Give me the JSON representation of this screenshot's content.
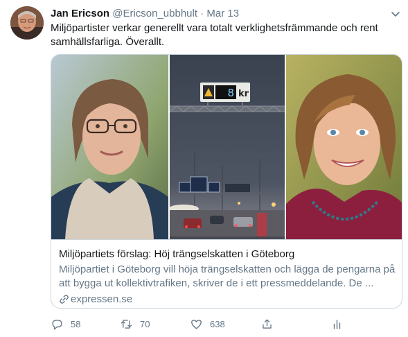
{
  "tweet": {
    "author_name": "Jan Ericson",
    "handle": "@Ericson_ubbhult",
    "separator": "·",
    "date": "Mar 13",
    "text": "Miljöpartister verkar generellt vara totalt verklighetsfrämmande och rent samhällsfarliga. Överallt."
  },
  "card": {
    "sign_value": "8",
    "sign_unit": "kr",
    "title": "Miljöpartiets förslag: Höj trängselskatten i Göteborg",
    "description": "Miljöpartiet i Göteborg vill höja trängselskatten och lägga de pengarna på att bygga ut kollektivtrafiken, skriver de i ett pressmeddelande. De ...",
    "domain": "expressen.se"
  },
  "actions": {
    "replies": "58",
    "retweets": "70",
    "likes": "638"
  },
  "icons": [
    "chevron-down-icon",
    "link-icon",
    "reply-icon",
    "retweet-icon",
    "like-icon",
    "share-icon",
    "analytics-icon"
  ],
  "colors": {
    "text": "#14171a",
    "secondary": "#657786",
    "border": "#ccd6dd"
  }
}
